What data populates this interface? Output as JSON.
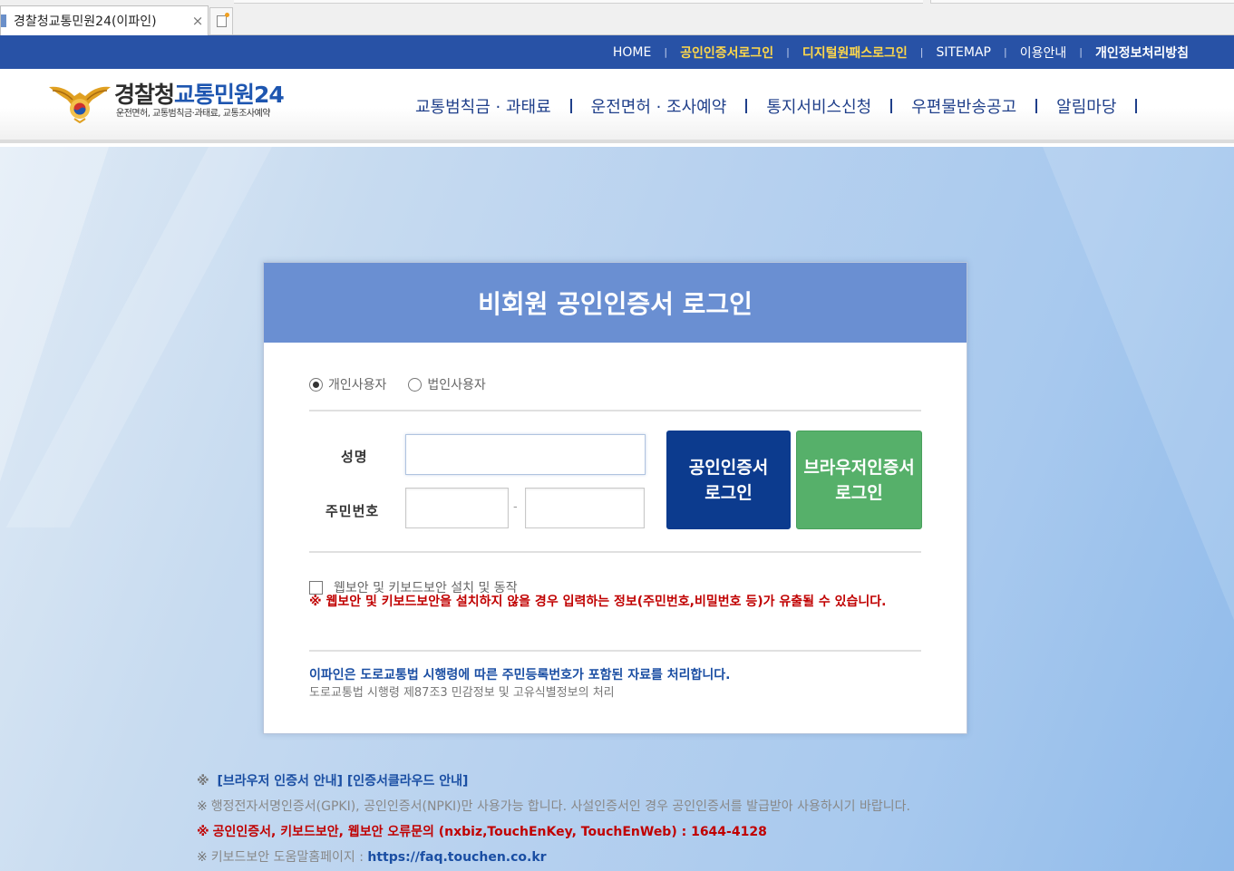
{
  "browser": {
    "tab_title": "경찰청교통민원24(이파인)",
    "close_glyph": "×"
  },
  "topbar": {
    "links": [
      {
        "label": "HOME",
        "style": "normal"
      },
      {
        "label": "공인인증서로그인",
        "style": "yellow"
      },
      {
        "label": "디지털원패스로그인",
        "style": "yellow"
      },
      {
        "label": "SITEMAP",
        "style": "normal"
      },
      {
        "label": "이용안내",
        "style": "normal"
      },
      {
        "label": "개인정보처리방침",
        "style": "bold"
      }
    ],
    "separator": "|",
    "bg_color": "#2852a6"
  },
  "logo": {
    "title_a": "경찰청",
    "title_b": "교통민원24",
    "subtitle": "운전면허, 교통범칙금·과태료, 교통조사예약"
  },
  "mainnav": {
    "items": [
      "교통범칙금 · 과태료",
      "운전면허 · 조사예약",
      "통지서비스신청",
      "우편물반송공고",
      "알림마당"
    ]
  },
  "login": {
    "title": "비회원 공인인증서 로그인",
    "user_types": [
      {
        "label": "개인사용자",
        "selected": true
      },
      {
        "label": "법인사용자",
        "selected": false
      }
    ],
    "name_label": "성명",
    "rrn_label": "주민번호",
    "rrn_dash": "-",
    "name_value": "",
    "rrn_front_value": "",
    "rrn_back_value": "",
    "cert_button": {
      "line1": "공인인증서",
      "line2": "로그인"
    },
    "browser_button": {
      "line1": "브라우저인증서",
      "line2": "로그인"
    },
    "security_checkbox_label": "웹보안 및 키보드보안 설치 및 동작",
    "security_checked": false,
    "warning": "※ 웹보안 및 키보드보안을 설치하지 않을 경우 입력하는 정보(주민번호,비밀번호 등)가 유출될 수 있습니다.",
    "info_line1": "이파인은 도로교통법 시행령에 따른 주민등록번호가 포함된 자료를 처리합니다.",
    "info_line2": "도로교통법 시행령 제87조3 민감정보 및 고유식별정보의 처리",
    "head_color": "#6a8fd2",
    "cert_color": "#0c3b8e",
    "browser_color": "#56b06a"
  },
  "notes": {
    "mark": "※",
    "n1_link1": "[브라우저 인증서 안내]",
    "n1_link2": "[인증서클라우드 안내]",
    "n2": "행정전자서명인증서(GPKI), 공인인증서(NPKI)만 사용가능 합니다. 사설인증서인 경우 공인인증서를 발급받아 사용하시기 바랍니다.",
    "n3": "공인인증서, 키보드보안, 웹보안 오류문의 (nxbiz,TouchEnKey, TouchEnWeb) : 1644-4128",
    "n4_label": "키보드보안 도움말홈페이지 : ",
    "n4_link": "https://faq.touchen.co.kr"
  }
}
